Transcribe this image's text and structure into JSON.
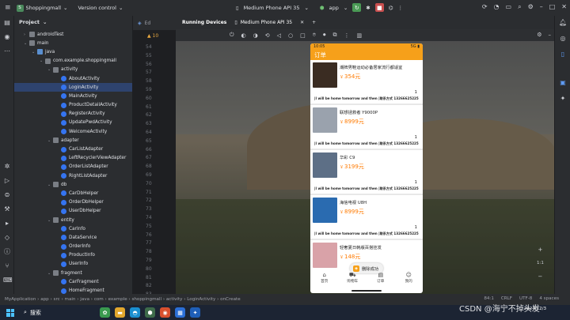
{
  "titlebar": {
    "project_badge": "S",
    "project_name": "Shoppingmall",
    "vcs": "Version control",
    "device": "Medium Phone API 35",
    "run_config": "app"
  },
  "project_panel": {
    "title": "Project",
    "tree": [
      {
        "label": "androidTest",
        "indent": 2,
        "kind": "folder",
        "twisty": "›"
      },
      {
        "label": "main",
        "indent": 2,
        "kind": "folder",
        "twisty": "⌄"
      },
      {
        "label": "java",
        "indent": 3,
        "kind": "folderb",
        "twisty": "⌄"
      },
      {
        "label": "com.example.shoppingmall",
        "indent": 4,
        "kind": "folder",
        "twisty": "⌄"
      },
      {
        "label": "activity",
        "indent": 5,
        "kind": "folder",
        "twisty": "⌄"
      },
      {
        "label": "AboutActivity",
        "indent": 6,
        "kind": "cls"
      },
      {
        "label": "LoginActivity",
        "indent": 6,
        "kind": "cls",
        "selected": true
      },
      {
        "label": "MainActivity",
        "indent": 6,
        "kind": "cls"
      },
      {
        "label": "ProductDetailActivity",
        "indent": 6,
        "kind": "cls"
      },
      {
        "label": "RegisterActivity",
        "indent": 6,
        "kind": "cls"
      },
      {
        "label": "UpdatePwdActivity",
        "indent": 6,
        "kind": "cls"
      },
      {
        "label": "WelcomeActivity",
        "indent": 6,
        "kind": "cls"
      },
      {
        "label": "adapter",
        "indent": 5,
        "kind": "folder",
        "twisty": "⌄"
      },
      {
        "label": "CarListAdapter",
        "indent": 6,
        "kind": "cls"
      },
      {
        "label": "LeftRecyclerViewAdapter",
        "indent": 6,
        "kind": "cls"
      },
      {
        "label": "OrderListAdapter",
        "indent": 6,
        "kind": "cls"
      },
      {
        "label": "RightListAdapter",
        "indent": 6,
        "kind": "cls"
      },
      {
        "label": "db",
        "indent": 5,
        "kind": "folder",
        "twisty": "⌄"
      },
      {
        "label": "CarDbHelper",
        "indent": 6,
        "kind": "cls"
      },
      {
        "label": "OrderDbHelper",
        "indent": 6,
        "kind": "cls"
      },
      {
        "label": "UserDbHelper",
        "indent": 6,
        "kind": "cls"
      },
      {
        "label": "entity",
        "indent": 5,
        "kind": "folder",
        "twisty": "⌄"
      },
      {
        "label": "CarInfo",
        "indent": 6,
        "kind": "cls"
      },
      {
        "label": "DataService",
        "indent": 6,
        "kind": "cls"
      },
      {
        "label": "OrderInfo",
        "indent": 6,
        "kind": "cls"
      },
      {
        "label": "ProductInfo",
        "indent": 6,
        "kind": "cls"
      },
      {
        "label": "UserInfo",
        "indent": 6,
        "kind": "cls"
      },
      {
        "label": "fragment",
        "indent": 5,
        "kind": "folder",
        "twisty": "⌄"
      },
      {
        "label": "CarFragment",
        "indent": 6,
        "kind": "cls"
      },
      {
        "label": "HomeFragment",
        "indent": 6,
        "kind": "cls"
      }
    ]
  },
  "editor": {
    "tab": "Ed",
    "warning_count": "10",
    "line_numbers": [
      "54",
      "55",
      "56",
      "57",
      "58",
      "59",
      "60",
      "61",
      "62",
      "63",
      "64",
      "65",
      "66",
      "67",
      "68",
      "69",
      "70",
      "71",
      "72",
      "73",
      "74",
      "75",
      "76",
      "77",
      "78",
      "79",
      "80",
      "81",
      "82",
      "83"
    ]
  },
  "running_devices": {
    "title": "Running Devices",
    "device_tab": "Medium Phone API 35"
  },
  "phone": {
    "time": "10:05",
    "signal": "5G",
    "title": "订单",
    "orders": [
      {
        "name": "潮牌男鞋运动必备居家流行都适宜",
        "yen": "￥",
        "price": "354元",
        "qty": "1",
        "msg": "|I will be home tomorrow and then |联系方式 13266625225",
        "img_color": "#3a2c22"
      },
      {
        "name": "联想拯救者 Y9000P",
        "yen": "￥",
        "price": "8999元",
        "qty": "1",
        "msg": "|I will be home tomorrow and then |联系方式 13266625225",
        "img_color": "#9aa2ad"
      },
      {
        "name": "华彩 C9",
        "yen": "￥",
        "price": "3199元",
        "qty": "1",
        "msg": "|I will be home tomorrow and then |联系方式 13266625225",
        "img_color": "#5d6f86"
      },
      {
        "name": "海信电视 U8H",
        "yen": "￥",
        "price": "8999元",
        "qty": "1",
        "msg": "|I will be home tomorrow and then |联系方式 13266625225",
        "img_color": "#2a6bb0"
      },
      {
        "name": "轻奢夏日韩版百搭挂发",
        "yen": "￥",
        "price": "148元",
        "qty": "1",
        "msg": "|I will be home tomorrow and then |联系方式 13266625225",
        "img_color": "#d9a2a8"
      }
    ],
    "toast": "删除成功",
    "nav": [
      {
        "label": "首页",
        "glyph": "⌂"
      },
      {
        "label": "购物车",
        "glyph": "⛟"
      },
      {
        "label": "订单",
        "glyph": "▤"
      },
      {
        "label": "我的",
        "glyph": "☺"
      }
    ]
  },
  "zoom": {
    "plus": "+",
    "ratio": "1:1",
    "minus": "−"
  },
  "statusbar": {
    "breadcrumb": [
      "MyApplication",
      "app",
      "src",
      "main",
      "java",
      "com",
      "example",
      "shoppingmall",
      "activity",
      "LoginActivity",
      "onCreate"
    ],
    "position": "84:1",
    "line_sep": "CRLF",
    "encoding": "UTF-8",
    "indent": "4 spaces"
  },
  "taskbar": {
    "search": "搜索",
    "date": "2024/12/3"
  },
  "watermark": "CSDN @海宁不掉头发"
}
